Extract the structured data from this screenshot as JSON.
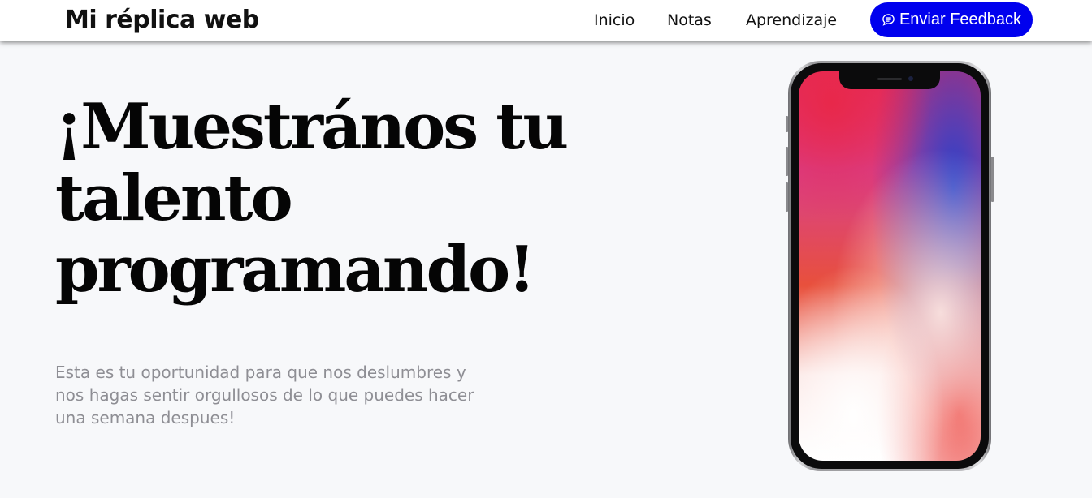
{
  "header": {
    "brand": "Mi réplica web",
    "nav": {
      "inicio": "Inicio",
      "notas": "Notas",
      "aprendizaje": "Aprendizaje"
    },
    "feedback_button": {
      "label": "Enviar Feedback",
      "icon": "chat-bubble-icon",
      "color": "#0000ee"
    }
  },
  "hero": {
    "title": "¡Muestrános tu talento programando!",
    "text": "Esta es tu oportunidad para que nos deslumbres y nos hagas sentir orgullosos de lo que puedes hacer una semana despues!",
    "image": "smartphone-image"
  },
  "colors": {
    "background": "#f7f8fa",
    "header_background": "#ffffff",
    "accent": "#0000ee",
    "title": "#050505",
    "muted_text": "#8e8e94"
  }
}
